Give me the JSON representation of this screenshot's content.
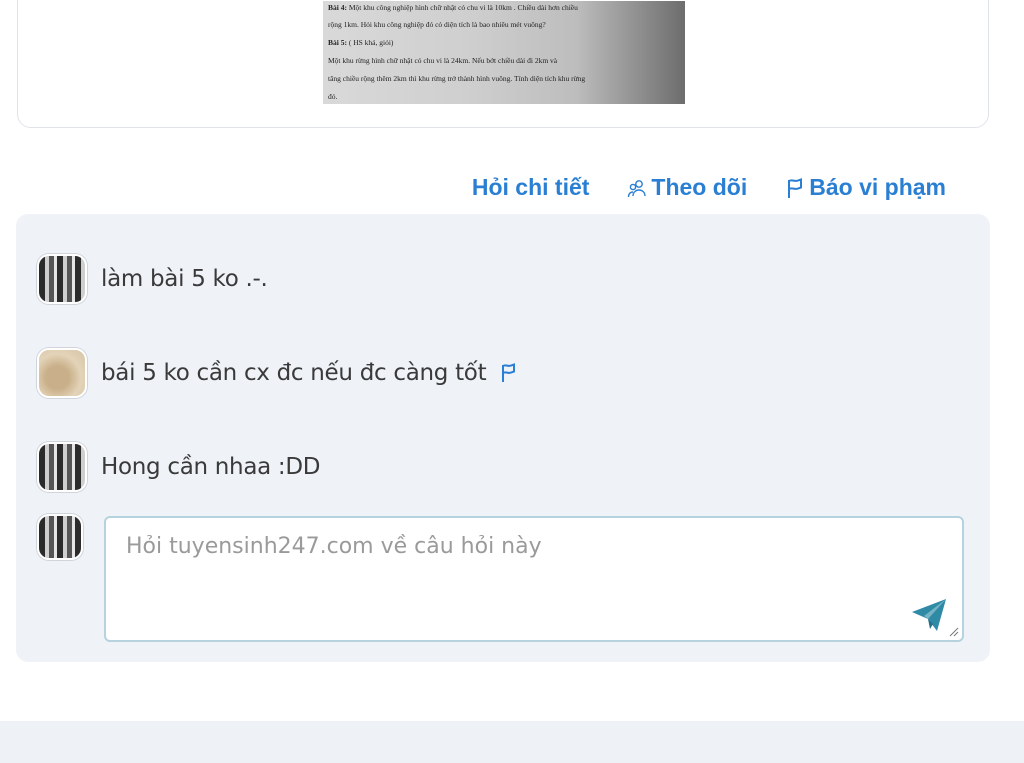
{
  "question_photo": {
    "lines": [
      {
        "bold": "Bài 4:",
        "text": " Một khu công nghiệp hình chữ nhật có chu vi là 10km . Chiều dài hơn chiều"
      },
      {
        "bold": "",
        "text": "rộng 1km. Hỏi khu công nghiệp đó có diện tích là bao nhiêu mét vuông?"
      },
      {
        "bold": "Bài 5:",
        "text": " ( HS khá, giỏi)"
      },
      {
        "bold": "",
        "text": "        Một khu rừng hình chữ nhật có chu vi là 24km. Nếu bớt chiều dài đi 2km và"
      },
      {
        "bold": "",
        "text": "tăng chiều rộng thêm 2km thì khu rừng trở thành hình vuông. Tính diện tích khu rừng"
      },
      {
        "bold": "",
        "text": "đó."
      }
    ]
  },
  "actions": {
    "ask_detail": "Hỏi chi tiết",
    "follow": "Theo dõi",
    "report": "Báo vi phạm"
  },
  "comments": [
    {
      "text": "làm  bài 5 ko .-.",
      "avatar": "photo1",
      "has_flag": false
    },
    {
      "text": "bái 5 ko cần cx đc nếu đc càng tốt",
      "avatar": "photo2",
      "has_flag": true
    },
    {
      "text": "Hong cần nhaa :DD",
      "avatar": "photo1",
      "has_flag": false
    }
  ],
  "reply": {
    "placeholder": "Hỏi tuyensinh247.com về câu hỏi này",
    "value": ""
  },
  "colors": {
    "accent": "#2b7fd3",
    "send_icon": "#2f8aa6",
    "comments_bg": "#eff3f8"
  },
  "icons": {
    "follow": "people-icon",
    "report": "flag-icon",
    "send": "paper-plane-icon"
  }
}
